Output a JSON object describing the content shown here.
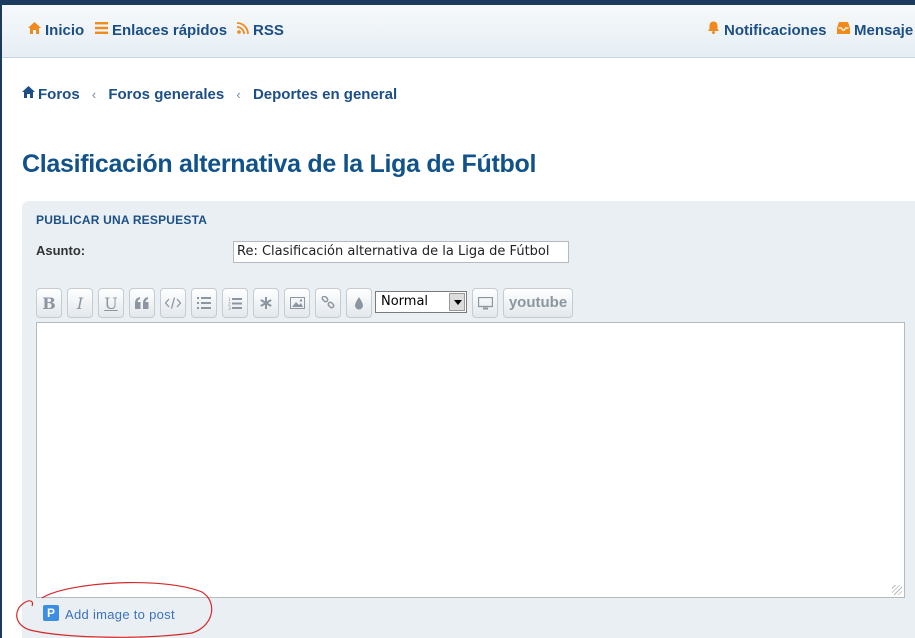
{
  "navbar": {
    "inicio": "Inicio",
    "enlaces": "Enlaces rápidos",
    "rss": "RSS",
    "notificaciones": "Notificaciones",
    "mensajes": "Mensaje"
  },
  "breadcrumb": {
    "home": "Foros",
    "level1": "Foros generales",
    "level2": "Deportes en general"
  },
  "page_title": "Clasificación alternativa de la Liga de Fútbol",
  "form": {
    "heading": "PUBLICAR UNA RESPUESTA",
    "subject_label": "Asunto:",
    "subject_value": "Re: Clasificación alternativa de la Liga de Fútbol",
    "toolbar": {
      "bold": "B",
      "italic": "I",
      "underline": "U",
      "font_size_selected": "Normal",
      "youtube": "youtube"
    },
    "message_body": "",
    "add_image_label": "Add image to post"
  },
  "colors": {
    "accent": "#1c4f86",
    "title": "#105289",
    "panel_bg": "#e9eff3",
    "nav_icon_orange": "#f08a1d",
    "annotation_red": "#d42a2a"
  }
}
